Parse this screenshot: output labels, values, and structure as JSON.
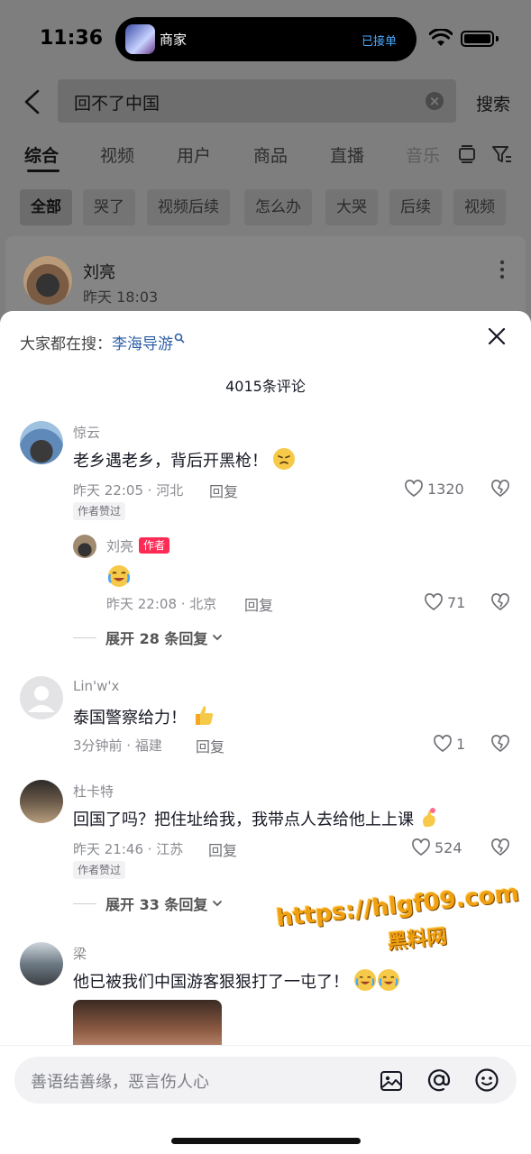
{
  "status_bar": {
    "time": "11:36",
    "island_title": "商家",
    "island_status": "已接单"
  },
  "search": {
    "query": "回不了中国",
    "button": "搜索"
  },
  "tabs": [
    "综合",
    "视频",
    "用户",
    "商品",
    "直播",
    "音乐"
  ],
  "chips": [
    "全部",
    "哭了",
    "视频后续",
    "怎么办",
    "大哭",
    "后续",
    "视频"
  ],
  "result": {
    "name": "刘亮",
    "time": "昨天 18:03"
  },
  "sheet": {
    "hot_prefix": "大家都在搜：",
    "hot_keyword": "李海导游",
    "count": "4015条评论",
    "comments": [
      {
        "name": "惊云",
        "text": "老乡遇老乡，背后开黑枪！",
        "meta": "昨天 22:05 · 河北",
        "reply": "回复",
        "likes": "1320",
        "author_liked": "作者赞过"
      },
      {
        "name": "刘亮",
        "tag": "作者",
        "meta": "昨天 22:08 · 北京",
        "reply": "回复",
        "likes": "71"
      },
      {
        "expand": "展开 28 条回复"
      },
      {
        "name": "Lin'w'x",
        "text": "泰国警察给力！",
        "meta": "3分钟前 · 福建",
        "reply": "回复",
        "likes": "1"
      },
      {
        "name": "杜卡特",
        "text": "回国了吗？把住址给我，我带点人去给他上上课",
        "meta": "昨天 21:46 · 江苏",
        "reply": "回复",
        "likes": "524",
        "author_liked": "作者赞过"
      },
      {
        "expand": "展开 33 条回复"
      },
      {
        "name": "梁",
        "text": "他已被我们中国游客狠狠打了一屯了！"
      }
    ]
  },
  "watermark": {
    "line1": "https://hlgf09.com",
    "line2": "黑料网"
  },
  "input": {
    "placeholder": "善语结善缘，恶言伤人心"
  },
  "icons": [
    "back-icon",
    "clear-icon",
    "layout-icon",
    "filter-icon",
    "more-icon",
    "close-icon",
    "heart-icon",
    "dislike-icon",
    "image-icon",
    "at-icon",
    "emoji-icon"
  ],
  "colors": {
    "author_tag": "#fe2c55",
    "keyword": "#2f5fa8",
    "watermark": "#f0a010"
  }
}
